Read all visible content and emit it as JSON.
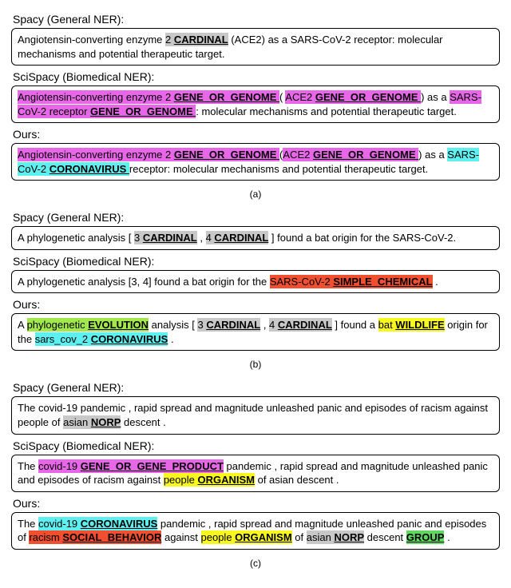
{
  "labels": {
    "spacy": "Spacy (General NER):",
    "scispacy": "SciSpacy (Biomedical NER):",
    "ours": "Ours:"
  },
  "captions": {
    "a": "(a)",
    "b": "(b)",
    "c": "(c)"
  },
  "a": {
    "spacy": {
      "t1": "Angiotensin-converting enzyme ",
      "h1": "2 ",
      "l1": "CARDINAL",
      "t2": " (ACE2) as a SARS-CoV-2 receptor: molecular mechanisms and potential therapeutic target."
    },
    "scispacy": {
      "h1": "Angiotensin-converting enzyme 2 ",
      "l1": " GENE_OR_GENOME ",
      "t1": " ( ",
      "h2": "ACE2 ",
      "l2": "GENE_OR_GENOME ",
      "t2": ") as a ",
      "h3": "SARS-CoV-2 receptor ",
      "l3": " GENE_OR_GENOME ",
      "t3": " : molecular mechanisms and potential therapeutic target."
    },
    "ours": {
      "h1": "Angiotensin-converting enzyme 2 ",
      "l1": " GENE_OR_GENOME ",
      "t1": " (",
      "h2": "ACE2 ",
      "l2": "GENE_OR_GENOME ",
      "t2": ") as a ",
      "h3": "SARS-CoV-2 ",
      "l3": " CORONAVIRUS ",
      "t3": "receptor: molecular mechanisms and potential therapeutic target."
    }
  },
  "b": {
    "spacy": {
      "t1": "A phylogenetic analysis [ ",
      "h1": "3 ",
      "l1": "CARDINAL",
      "t2": " , ",
      "h2": "4 ",
      "l2": "CARDINAL",
      "t3": " ] found a bat origin for the SARS-CoV-2."
    },
    "scispacy": {
      "t1": "A phylogenetic analysis [3, 4] found a bat origin for the ",
      "h1": "SARS-CoV-2 ",
      "l1": "SIMPLE_CHEMICAL",
      "t2": " ."
    },
    "ours": {
      "t1": "A ",
      "h1": "phylogenetic ",
      "l1": "EVOLUTION",
      "t2": " analysis [ ",
      "h2": "3 ",
      "l2": "CARDINAL",
      "t3": " , ",
      "h3": "4 ",
      "l3": "CARDINAL",
      "t4": " ] found a ",
      "h4": "bat ",
      "l4": "WILDLIFE",
      "t5": " origin for the ",
      "h5": "sars_cov_2 ",
      "l5": "CORONAVIRUS",
      "t6": " ."
    }
  },
  "c": {
    "spacy": {
      "t1": "The covid-19 pandemic , rapid spread and magnitude unleashed panic and episodes of racism against people of ",
      "h1": "asian ",
      "l1": "NORP",
      "t2": " descent ."
    },
    "scispacy": {
      "t1": "The ",
      "h1": "covid-19 ",
      "l1": "GENE_OR_GENE_PRODUCT",
      "t2": " pandemic , rapid spread and magnitude unleashed panic and episodes of racism against ",
      "h2": "people ",
      "l2": "ORGANISM",
      "t3": " of asian descent ."
    },
    "ours": {
      "t1": "The ",
      "h1": "covid-19 ",
      "l1": "CORONAVIRUS",
      "t2": " pandemic , rapid spread and magnitude unleashed panic and episodes of ",
      "h2": "racism ",
      "l2": "SOCIAL_BEHAVIOR",
      "t3": " against ",
      "h3": "people ",
      "l3": "ORGANISM",
      "t4": " of ",
      "h4": "asian ",
      "l4": "NORP",
      "t5": " descent ",
      "h5": "GROUP",
      "t6": " ."
    }
  }
}
